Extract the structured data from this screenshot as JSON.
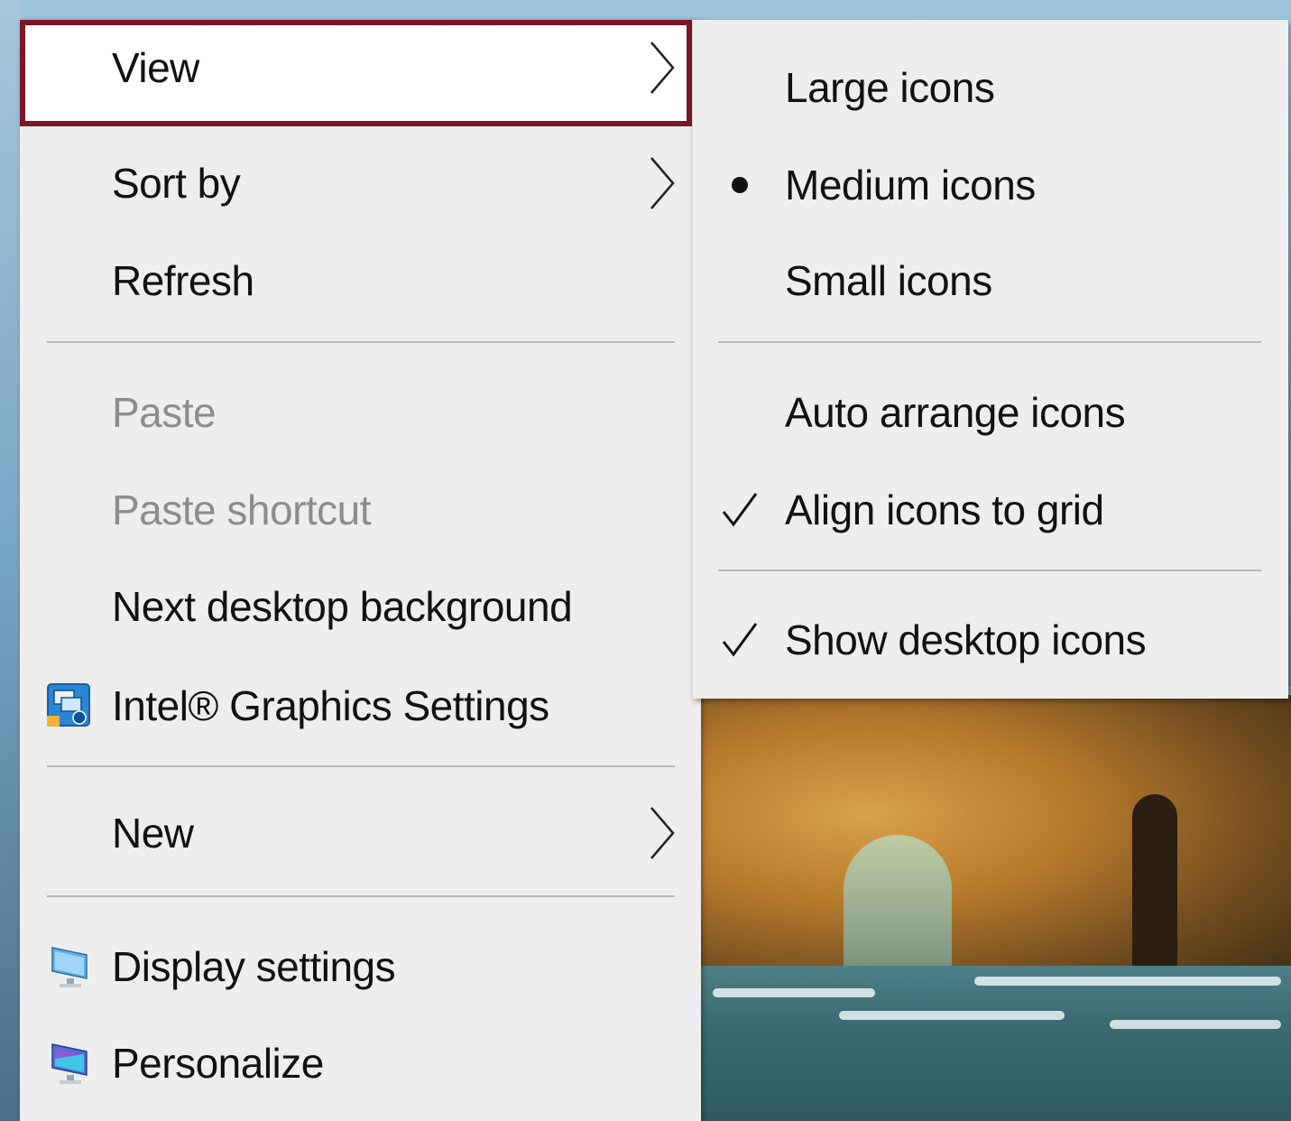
{
  "context_menu": {
    "items": [
      {
        "label": "View"
      },
      {
        "label": "Sort by"
      },
      {
        "label": "Refresh"
      },
      {
        "label": "Paste"
      },
      {
        "label": "Paste shortcut"
      },
      {
        "label": "Next desktop background"
      },
      {
        "label": "Intel® Graphics Settings",
        "icon": "intel-graphics-icon"
      },
      {
        "label": "New"
      },
      {
        "label": "Display settings",
        "icon": "display-settings-icon"
      },
      {
        "label": "Personalize",
        "icon": "personalize-icon"
      }
    ],
    "highlighted_item": "View",
    "highlight_color": "#7d1528"
  },
  "view_submenu": {
    "items": [
      {
        "label": "Large icons",
        "state": "none"
      },
      {
        "label": "Medium icons",
        "state": "selected-radio"
      },
      {
        "label": "Small icons",
        "state": "none"
      },
      {
        "label": "Auto arrange icons",
        "state": "none"
      },
      {
        "label": "Align icons to grid",
        "state": "checked"
      },
      {
        "label": "Show desktop icons",
        "state": "checked"
      }
    ]
  }
}
